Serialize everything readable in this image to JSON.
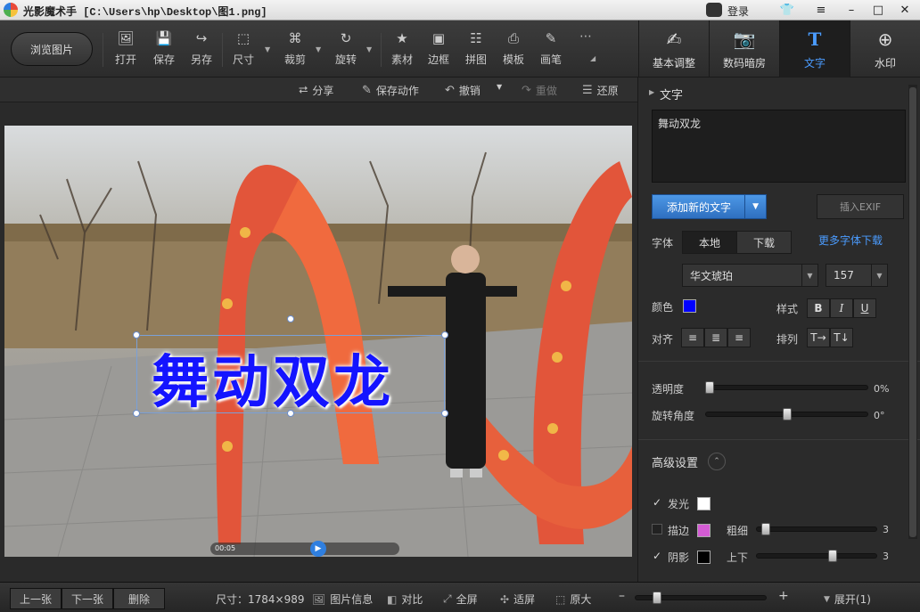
{
  "window": {
    "title": "光影魔术手 [C:\\Users\\hp\\Desktop\\图1.png]",
    "login": "登录"
  },
  "toolbar": {
    "browse": "浏览图片",
    "tools": [
      {
        "label": "打开",
        "icon": "open-icon"
      },
      {
        "label": "保存",
        "icon": "save-icon"
      },
      {
        "label": "另存",
        "icon": "save-as-icon"
      },
      {
        "label": "尺寸",
        "icon": "resize-icon"
      },
      {
        "label": "裁剪",
        "icon": "crop-icon"
      },
      {
        "label": "旋转",
        "icon": "rotate-icon"
      },
      {
        "label": "素材",
        "icon": "material-icon"
      },
      {
        "label": "边框",
        "icon": "border-icon"
      },
      {
        "label": "拼图",
        "icon": "collage-icon"
      },
      {
        "label": "模板",
        "icon": "template-icon"
      },
      {
        "label": "画笔",
        "icon": "brush-icon"
      }
    ]
  },
  "tabs": [
    {
      "label": "基本调整",
      "icon": "adjust-icon"
    },
    {
      "label": "数码暗房",
      "icon": "camera-icon"
    },
    {
      "label": "文字",
      "icon": "text-icon",
      "active": true
    },
    {
      "label": "水印",
      "icon": "watermark-icon"
    }
  ],
  "actions": {
    "share": "分享",
    "save_action": "保存动作",
    "undo": "撤销",
    "redo": "重做",
    "restore": "还原"
  },
  "canvas": {
    "overlay_text": "舞动双龙",
    "video_time": "00:05"
  },
  "panel": {
    "section_title": "文字",
    "text_value": "舞动双龙",
    "add_text": "添加新的文字",
    "insert_exif": "插入EXIF",
    "font_label": "字体",
    "font_local": "本地",
    "font_download": "下载",
    "more_fonts": "更多字体下载",
    "font_name": "华文琥珀",
    "font_size": "157",
    "color_label": "颜色",
    "text_color": "#0000ff",
    "style_label": "样式",
    "style_bold": "B",
    "style_italic": "I",
    "style_underline": "U",
    "align_label": "对齐",
    "arrange_label": "排列",
    "opacity_label": "透明度",
    "opacity_value": "0%",
    "opacity_level": 0,
    "rotate_label": "旋转角度",
    "rotate_value": "0°",
    "rotate_level": 0.5,
    "advanced_title": "高级设置",
    "glow_label": "发光",
    "glow_color": "#ffffff",
    "stroke_label": "描边",
    "stroke_color": "#d45cd4",
    "thickness_label": "粗细",
    "thickness_value": "3",
    "shadow_label": "阴影",
    "shadow_color": "#000000",
    "vertical_label": "上下",
    "vertical_value": "3"
  },
  "statusbar": {
    "prev": "上一张",
    "next": "下一张",
    "delete": "删除",
    "size": "尺寸：1784×989",
    "info": "图片信息",
    "compare": "对比",
    "fullscreen": "全屏",
    "fit": "适屏",
    "original": "原大",
    "expand": "展开(1)"
  }
}
